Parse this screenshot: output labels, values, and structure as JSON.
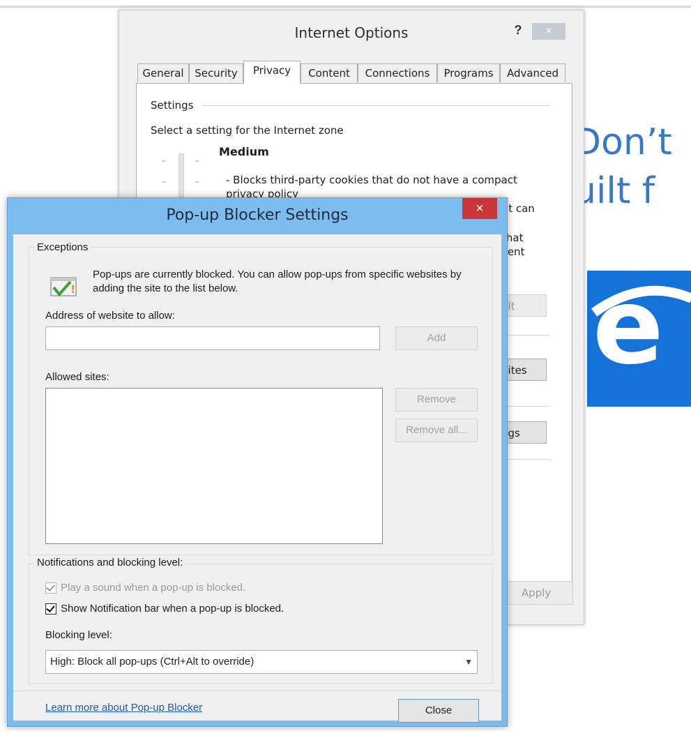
{
  "background": {
    "promo_line1": "Don’t",
    "promo_line2": "uilt f",
    "promo_tile_icon": "internet-explorer-logo"
  },
  "internet_options": {
    "title": "Internet Options",
    "help_glyph": "?",
    "close_glyph": "×",
    "tabs": [
      "General",
      "Security",
      "Privacy",
      "Content",
      "Connections",
      "Programs",
      "Advanced"
    ],
    "active_tab": "Privacy",
    "settings_label": "Settings",
    "zone_text": "Select a setting for the Internet zone",
    "level": "Medium",
    "description": "- Blocks third-party cookies that do not have a compact privacy policy",
    "fragments": [
      "at can",
      "c",
      "that",
      "sent"
    ],
    "default_btn": "ult",
    "sites_btn": "Sites",
    "settings_btn": "ngs",
    "apply_btn": "Apply"
  },
  "popup_blocker": {
    "title": "Pop-up Blocker Settings",
    "close_glyph": "×",
    "exceptions_label": "Exceptions",
    "info_icon": "warning-check-icon",
    "info_text": "Pop-ups are currently blocked.  You can allow pop-ups from specific websites by adding the site to the list below.",
    "address_label": "Address of website to allow:",
    "address_value": "",
    "add_btn": "Add",
    "allowed_label": "Allowed sites:",
    "allowed_sites": [],
    "remove_btn": "Remove",
    "remove_all_btn": "Remove all...",
    "notifications_label": "Notifications and blocking level:",
    "play_sound": "Play a sound when a pop-up is blocked.",
    "show_notification": "Show Notification bar when a pop-up is blocked.",
    "blocking_label": "Blocking level:",
    "blocking_value": "High: Block all pop-ups (Ctrl+Alt to override)",
    "learn_more": "Learn more about Pop-up Blocker",
    "close_btn": "Close"
  }
}
